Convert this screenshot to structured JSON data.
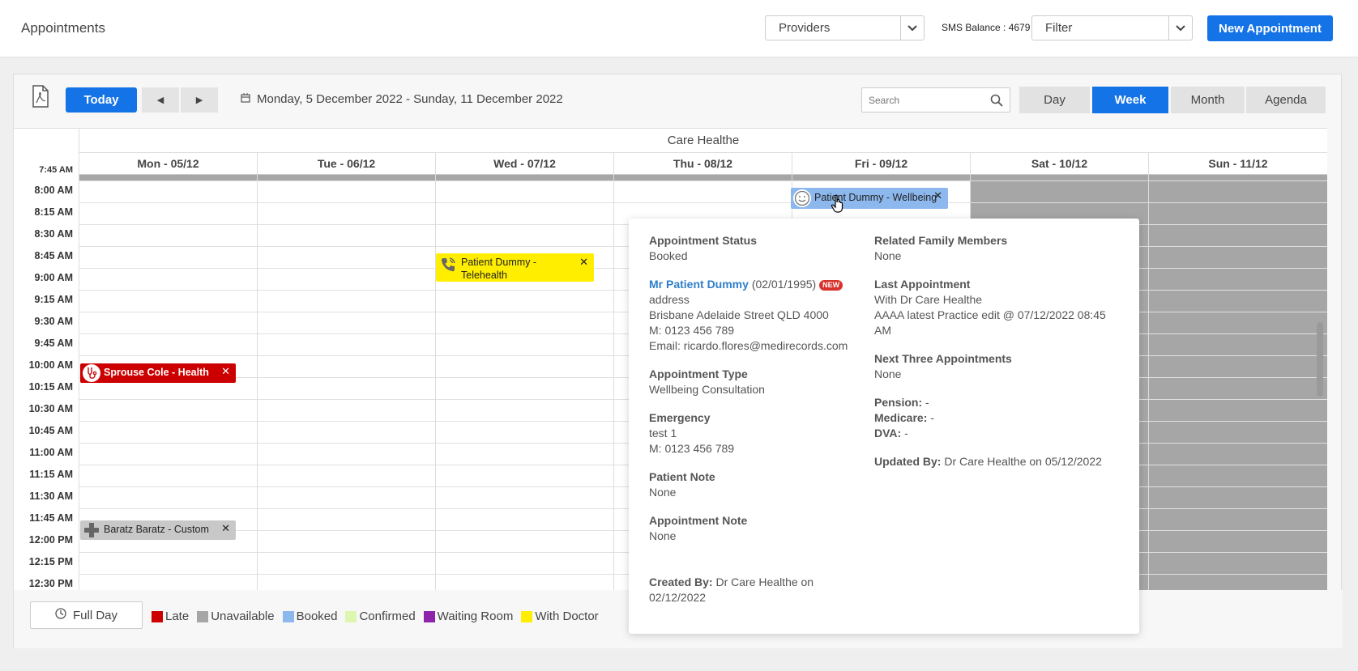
{
  "header": {
    "title": "Appointments",
    "providers_label": "Providers",
    "sms_balance": "SMS Balance : 4679",
    "filter_label": "Filter",
    "new_appointment_label": "New Appointment"
  },
  "toolbar": {
    "today_label": "Today",
    "prev_icon": "chevron-left-icon",
    "next_icon": "chevron-right-icon",
    "date_range": "Monday, 5 December 2022 - Sunday, 11 December 2022",
    "search_placeholder": "Search",
    "views": [
      {
        "label": "Day",
        "active": false
      },
      {
        "label": "Week",
        "active": true
      },
      {
        "label": "Month",
        "active": false
      },
      {
        "label": "Agenda",
        "active": false
      }
    ]
  },
  "calendar": {
    "provider": "Care Healthe",
    "days": [
      "Mon - 05/12",
      "Tue - 06/12",
      "Wed - 07/12",
      "Thu - 08/12",
      "Fri - 09/12",
      "Sat - 10/12",
      "Sun - 11/12"
    ],
    "partial_time": "7:45 AM",
    "times": [
      "8:00 AM",
      "8:15 AM",
      "8:30 AM",
      "8:45 AM",
      "9:00 AM",
      "9:15 AM",
      "9:30 AM",
      "9:45 AM",
      "10:00 AM",
      "10:15 AM",
      "10:30 AM",
      "10:45 AM",
      "11:00 AM",
      "11:15 AM",
      "11:30 AM",
      "11:45 AM",
      "12:00 PM",
      "12:15 PM",
      "12:30 PM"
    ],
    "appointments": [
      {
        "label": "Patient Dummy - Wellbeing",
        "day": "Fri - 09/12",
        "time": "8:00 AM",
        "status": "Booked",
        "color": "#8cb8ee",
        "icon": "smiley-icon"
      },
      {
        "label": "Patient Dummy - Telehealth",
        "day": "Wed - 07/12",
        "time": "8:45 AM",
        "status": "With Doctor",
        "color": "#ffee00",
        "icon": "phone-icon"
      },
      {
        "label": "Sprouse Cole - Health",
        "day": "Mon - 05/12",
        "time": "10:00 AM",
        "status": "Late",
        "color": "#cc0000",
        "icon": "stethoscope-icon"
      },
      {
        "label": "Baratz Baratz - Custom",
        "day": "Mon - 05/12",
        "time": "12:00 PM",
        "status": "Unavailable",
        "color": "#c8c8c8",
        "icon": "medical-cross-icon"
      }
    ]
  },
  "legend": {
    "full_day_label": "Full Day",
    "items": [
      {
        "label": "Late",
        "color": "#cc0000"
      },
      {
        "label": "Unavailable",
        "color": "#a6a6a6"
      },
      {
        "label": "Booked",
        "color": "#8cb8ee"
      },
      {
        "label": "Confirmed",
        "color": "#ddf7b0"
      },
      {
        "label": "Waiting Room",
        "color": "#8e24aa"
      },
      {
        "label": "With Doctor",
        "color": "#ffee00"
      }
    ]
  },
  "popup": {
    "status_title": "Appointment Status",
    "status_value": "Booked",
    "patient_name": "Mr Patient Dummy",
    "patient_dob": "(02/01/1995)",
    "new_badge": "NEW",
    "address_label": "address",
    "address": "Brisbane Adelaide Street QLD 4000",
    "mobile": "M: 0123 456 789",
    "email": "Email: ricardo.flores@medirecords.com",
    "type_title": "Appointment Type",
    "type_value": "Wellbeing Consultation",
    "emergency_title": "Emergency",
    "emergency_name": "test 1",
    "emergency_mobile": "M: 0123 456 789",
    "patient_note_title": "Patient Note",
    "patient_note_value": "None",
    "appt_note_title": "Appointment Note",
    "appt_note_value": "None",
    "created_by_label": "Created By:",
    "created_by_value": "Dr Care Healthe on 02/12/2022",
    "family_title": "Related Family Members",
    "family_value": "None",
    "last_title": "Last Appointment",
    "last_line1": "With Dr Care Healthe",
    "last_line2": "AAAA latest Practice edit @ 07/12/2022 08:45 AM",
    "next_title": "Next Three Appointments",
    "next_value": "None",
    "pension_label": "Pension:",
    "pension_value": "-",
    "medicare_label": "Medicare:",
    "medicare_value": "-",
    "dva_label": "DVA:",
    "dva_value": "-",
    "updated_by_label": "Updated By:",
    "updated_by_value": "Dr Care Healthe on 05/12/2022"
  }
}
